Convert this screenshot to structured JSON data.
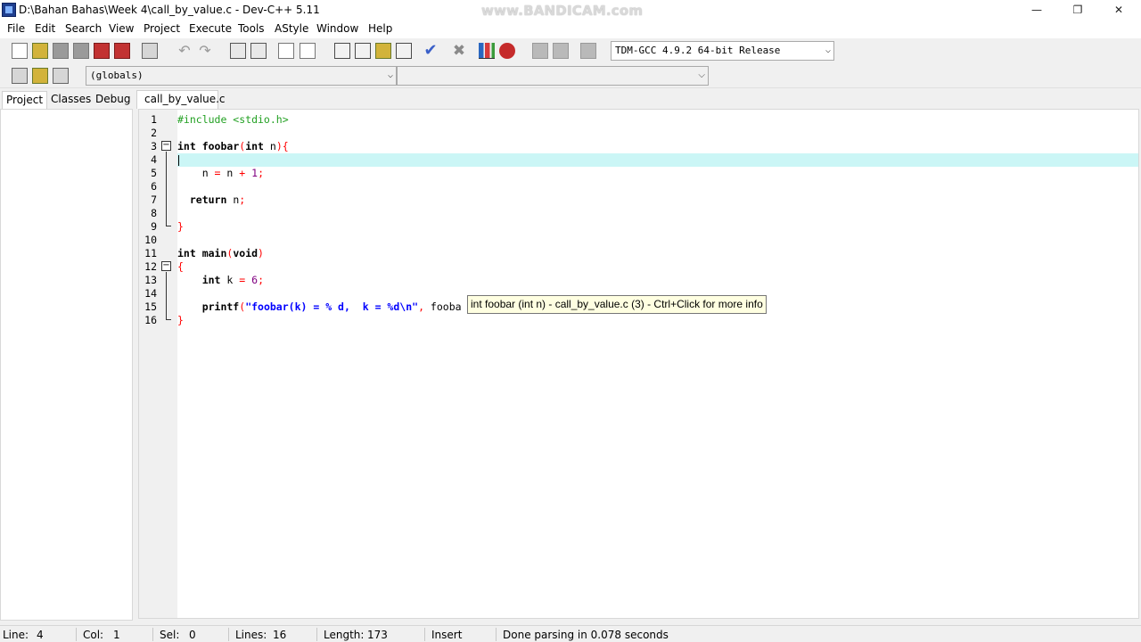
{
  "window": {
    "title": "D:\\Bahan Bahas\\Week 4\\call_by_value.c - Dev-C++ 5.11",
    "watermark": "www.BANDICAM.com",
    "minimize": "—",
    "restore": "❐",
    "close": "✕"
  },
  "menu": [
    "File",
    "Edit",
    "Search",
    "View",
    "Project",
    "Execute",
    "Tools",
    "AStyle",
    "Window",
    "Help"
  ],
  "toolbar": {
    "compiler": "TDM-GCC 4.9.2 64-bit Release",
    "globals": "(globals)",
    "members": ""
  },
  "left_tabs": [
    "Project",
    "Classes",
    "Debug"
  ],
  "editor_tab": "call_by_value.c",
  "code": {
    "line_numbers": [
      "1",
      "2",
      "3",
      "4",
      "5",
      "6",
      "7",
      "8",
      "9",
      "10",
      "11",
      "12",
      "13",
      "14",
      "15",
      "16"
    ],
    "current_line": 4,
    "lines": [
      [
        {
          "t": "#include <stdio.h>",
          "c": "pre"
        }
      ],
      [],
      [
        {
          "t": "int",
          "c": "kw"
        },
        {
          "t": " foobar",
          "c": "kw"
        },
        {
          "t": "(",
          "c": "sym"
        },
        {
          "t": "int",
          "c": "kw"
        },
        {
          "t": " n",
          "c": "id"
        },
        {
          "t": "){",
          "c": "sym"
        }
      ],
      [],
      [
        {
          "t": "    n ",
          "c": "id"
        },
        {
          "t": "=",
          "c": "sym"
        },
        {
          "t": " n ",
          "c": "id"
        },
        {
          "t": "+",
          "c": "sym"
        },
        {
          "t": " ",
          "c": "id"
        },
        {
          "t": "1",
          "c": "num"
        },
        {
          "t": ";",
          "c": "sym"
        }
      ],
      [],
      [
        {
          "t": "  return",
          "c": "kw"
        },
        {
          "t": " n",
          "c": "id"
        },
        {
          "t": ";",
          "c": "sym"
        }
      ],
      [],
      [
        {
          "t": "}",
          "c": "sym"
        }
      ],
      [],
      [
        {
          "t": "int",
          "c": "kw"
        },
        {
          "t": " main",
          "c": "kw"
        },
        {
          "t": "(",
          "c": "sym"
        },
        {
          "t": "void",
          "c": "kw"
        },
        {
          "t": ")",
          "c": "sym"
        }
      ],
      [
        {
          "t": "{",
          "c": "sym"
        }
      ],
      [
        {
          "t": "    int",
          "c": "kw"
        },
        {
          "t": " k ",
          "c": "id"
        },
        {
          "t": "=",
          "c": "sym"
        },
        {
          "t": " ",
          "c": "id"
        },
        {
          "t": "6",
          "c": "num"
        },
        {
          "t": ";",
          "c": "sym"
        }
      ],
      [],
      [
        {
          "t": "    printf",
          "c": "kw"
        },
        {
          "t": "(",
          "c": "sym"
        },
        {
          "t": "\"foobar(k) = % d,  k = %d\\n\"",
          "c": "str"
        },
        {
          "t": ", ",
          "c": "sym"
        },
        {
          "t": "fooba",
          "c": "id"
        }
      ],
      [
        {
          "t": "}",
          "c": "sym"
        }
      ]
    ]
  },
  "tooltip": "int foobar (int n) - call_by_value.c (3) - Ctrl+Click for more info",
  "status": {
    "line_label": "Line:",
    "line_value": "4",
    "col_label": "Col:",
    "col_value": "1",
    "sel_label": "Sel:",
    "sel_value": "0",
    "lines_label": "Lines:",
    "lines_value": "16",
    "length_label": "Length:",
    "length_value": "173",
    "mode": "Insert",
    "message": "Done parsing in 0.078 seconds"
  }
}
